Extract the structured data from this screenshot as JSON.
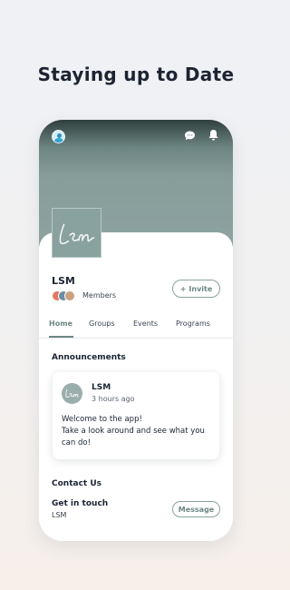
{
  "headline": "Staying up to Date",
  "colors": {
    "accent": "#6e8683",
    "banner": "#8ea3a1",
    "text_dark": "#1c2433"
  },
  "topbar": {
    "icons": [
      "profile-avatar",
      "chat-bubble-icon",
      "bell-icon"
    ]
  },
  "group": {
    "logo_text": "LSM",
    "name": "LSM",
    "members_label": "Members",
    "invite_label": "Invite"
  },
  "tabs": [
    {
      "label": "Home",
      "active": true
    },
    {
      "label": "Groups",
      "active": false
    },
    {
      "label": "Events",
      "active": false
    },
    {
      "label": "Programs",
      "active": false
    }
  ],
  "announcements": {
    "title": "Announcements",
    "post": {
      "author": "LSM",
      "time": "3 hours ago",
      "lines": [
        "Welcome to the app!",
        "Take a look around and see what you",
        "can do!"
      ]
    }
  },
  "contact": {
    "title": "Contact Us",
    "subtitle": "Get in touch",
    "org": "LSM",
    "message_label": "Message"
  }
}
